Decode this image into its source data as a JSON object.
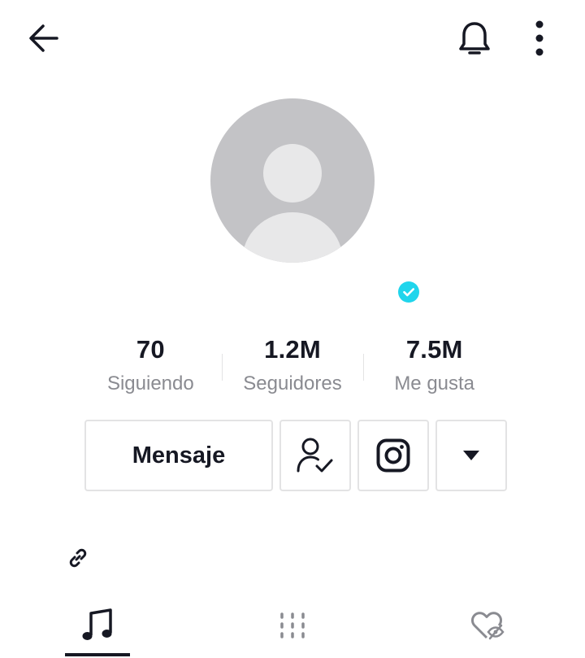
{
  "header": {
    "back_icon": "arrow-left-icon",
    "notifications_icon": "bell-icon",
    "more_icon": "more-vertical-icon"
  },
  "profile": {
    "avatar_icon": "default-avatar-icon",
    "verified_icon": "verified-badge-icon",
    "verified_color": "#20d5ec"
  },
  "stats": {
    "following": {
      "value": "70",
      "label": "Siguiendo"
    },
    "followers": {
      "value": "1.2M",
      "label": "Seguidores"
    },
    "likes": {
      "value": "7.5M",
      "label": "Me gusta"
    }
  },
  "actions": {
    "message_label": "Mensaje",
    "following_icon": "user-check-icon",
    "instagram_icon": "instagram-icon",
    "dropdown_icon": "caret-down-icon"
  },
  "bio": {
    "link_icon": "link-icon"
  },
  "tabs": [
    {
      "icon": "music-note-icon",
      "selected": true
    },
    {
      "icon": "grid-icon",
      "selected": false
    },
    {
      "icon": "hidden-heart-icon",
      "selected": false
    }
  ],
  "colors": {
    "text": "#161823",
    "secondary_text": "#8a8b91",
    "border": "#e3e3e4",
    "avatar_bg": "#c3c3c6"
  }
}
